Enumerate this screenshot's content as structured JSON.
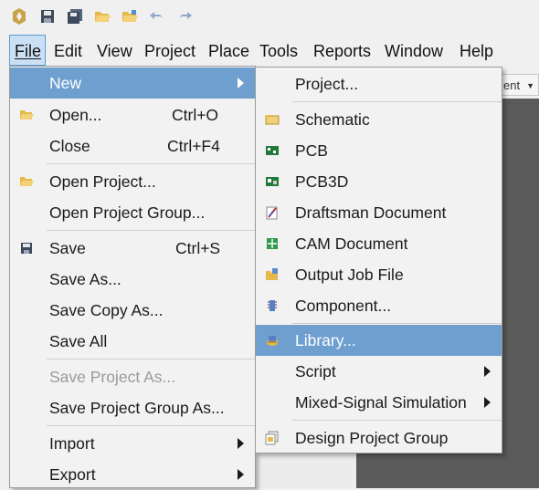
{
  "toolbar": {
    "buttons": [
      {
        "name": "app-logo-icon"
      },
      {
        "name": "save-icon"
      },
      {
        "name": "save-all-icon"
      },
      {
        "name": "open-folder-icon"
      },
      {
        "name": "open-project-icon"
      },
      {
        "name": "undo-icon"
      },
      {
        "name": "redo-icon"
      }
    ]
  },
  "menubar": {
    "items": [
      {
        "label": "File"
      },
      {
        "label": "Edit"
      },
      {
        "label": "View"
      },
      {
        "label": "Project"
      },
      {
        "label": "Place"
      },
      {
        "label": "Tools"
      },
      {
        "label": "Reports"
      },
      {
        "label": "Window"
      },
      {
        "label": "Help"
      }
    ]
  },
  "background": {
    "dropdown_fragment": "ent"
  },
  "file_menu": {
    "items": [
      {
        "label": "New"
      },
      {
        "label": "Open...",
        "shortcut": "Ctrl+O"
      },
      {
        "label": "Close",
        "shortcut": "Ctrl+F4"
      },
      {
        "label": "Open Project..."
      },
      {
        "label": "Open Project Group..."
      },
      {
        "label": "Save",
        "shortcut": "Ctrl+S"
      },
      {
        "label": "Save As..."
      },
      {
        "label": "Save Copy As..."
      },
      {
        "label": "Save All"
      },
      {
        "label": "Save Project As..."
      },
      {
        "label": "Save Project Group As..."
      },
      {
        "label": "Import"
      },
      {
        "label": "Export"
      }
    ]
  },
  "new_submenu": {
    "items": [
      {
        "label": "Project..."
      },
      {
        "label": "Schematic"
      },
      {
        "label": "PCB"
      },
      {
        "label": "PCB3D"
      },
      {
        "label": "Draftsman Document"
      },
      {
        "label": "CAM Document"
      },
      {
        "label": "Output Job File"
      },
      {
        "label": "Component..."
      },
      {
        "label": "Library..."
      },
      {
        "label": "Script"
      },
      {
        "label": "Mixed-Signal Simulation"
      },
      {
        "label": "Design Project Group"
      }
    ]
  },
  "colors": {
    "highlight": "#6e9fcf",
    "menu_bg": "#f2f2f2",
    "active_menubar": "#cce0f5"
  }
}
